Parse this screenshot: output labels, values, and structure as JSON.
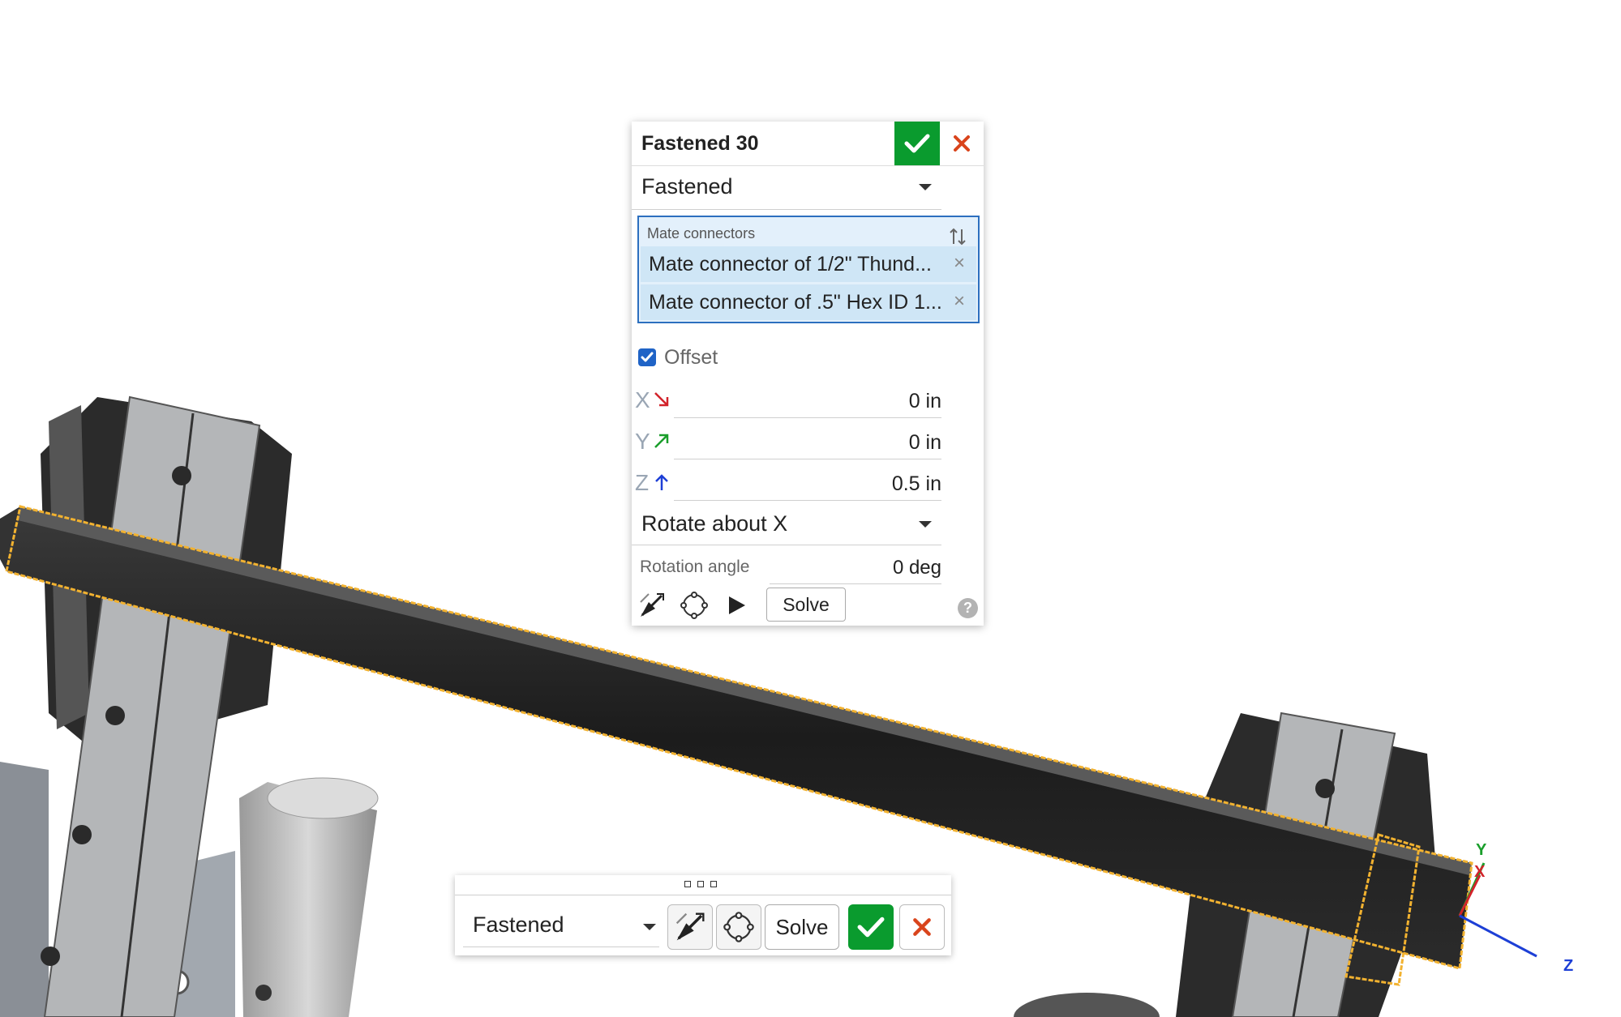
{
  "dialog": {
    "title": "Fastened 30",
    "mate_type": "Fastened",
    "mate_connectors": {
      "label": "Mate connectors",
      "items": [
        "Mate connector of 1/2\" Thund...",
        "Mate connector of .5\" Hex ID 1..."
      ]
    },
    "offset": {
      "label": "Offset",
      "checked": true
    },
    "axes": [
      {
        "letter": "X",
        "value": "0 in",
        "color": "#d2232a"
      },
      {
        "letter": "Y",
        "value": "0 in",
        "color": "#1a9e2b"
      },
      {
        "letter": "Z",
        "value": "0.5 in",
        "color": "#1d3fd6"
      }
    ],
    "rotate_option": "Rotate about X",
    "rotation_angle": {
      "label": "Rotation angle",
      "value": "0 deg"
    },
    "solve_label": "Solve",
    "help_glyph": "?"
  },
  "mini_toolbar": {
    "mate_type": "Fastened",
    "solve_label": "Solve"
  },
  "triad": {
    "x": "X",
    "y": "Y",
    "z": "Z"
  },
  "colors": {
    "accept": "#0a9b2e",
    "cancel": "#d9441c",
    "selection": "#f2b230",
    "selection_bg": "#e3f0fb",
    "selection_border": "#2c6fbf"
  }
}
